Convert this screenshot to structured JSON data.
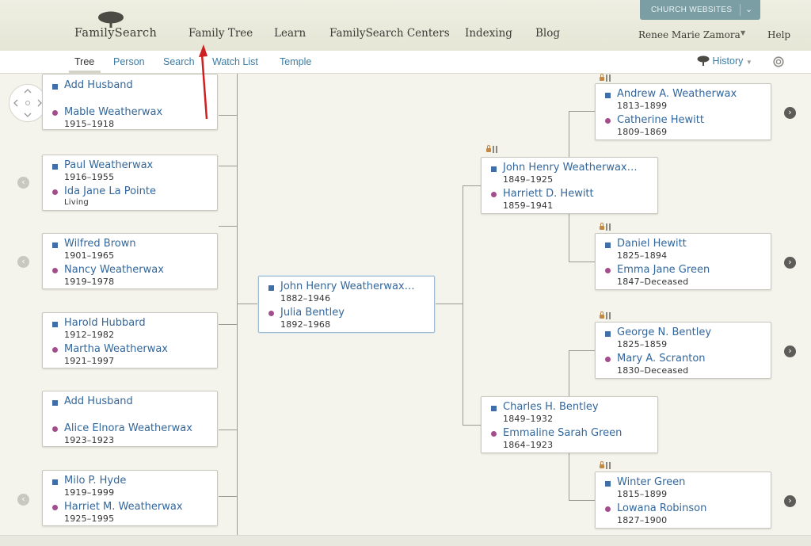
{
  "header": {
    "logo_text": "FamilySearch",
    "nav": [
      "Family Tree",
      "Learn",
      "FamilySearch Centers",
      "Indexing",
      "Blog"
    ],
    "church_websites": "CHURCH WEBSITES",
    "user_name": "Renee Marie Zamora",
    "help": "Help"
  },
  "subnav": {
    "items": [
      "Tree",
      "Person",
      "Search",
      "Watch List",
      "Temple"
    ],
    "active": "Tree",
    "history": "History"
  },
  "colors": {
    "link": "#33679c",
    "male": "#3f6ea8",
    "female": "#a24d8c",
    "annotation_arrow": "#d01f1f"
  },
  "zoom_controls": {
    "minus": "−",
    "plus": "+"
  },
  "children": [
    {
      "husband": "Add Husband",
      "husband_life": "",
      "wife": "Mable Weatherwax",
      "wife_life": "1915–1918"
    },
    {
      "husband": "Paul Weatherwax",
      "husband_life": "1916–1955",
      "wife": "Ida Jane La Pointe",
      "wife_life": "Living"
    },
    {
      "husband": "Wilfred Brown",
      "husband_life": "1901–1965",
      "wife": "Nancy Weatherwax",
      "wife_life": "1919–1978"
    },
    {
      "husband": "Harold Hubbard",
      "husband_life": "1912–1982",
      "wife": "Martha Weatherwax",
      "wife_life": "1921–1997"
    },
    {
      "husband": "Add Husband",
      "husband_life": "",
      "wife": "Alice Elnora Weatherwax",
      "wife_life": "1923–1923"
    },
    {
      "husband": "Milo P. Hyde",
      "husband_life": "1919–1999",
      "wife": "Harriet M. Weatherwax",
      "wife_life": "1925–1995"
    }
  ],
  "focus_couple": {
    "husband": "John Henry Weatherwax…",
    "husband_life": "1882–1946",
    "wife": "Julia Bentley",
    "wife_life": "1892–1968"
  },
  "parents": [
    {
      "husband": "John Henry Weatherwax…",
      "husband_life": "1849–1925",
      "wife": "Harriett D. Hewitt",
      "wife_life": "1859–1941"
    },
    {
      "husband": "Charles H. Bentley",
      "husband_life": "1849–1932",
      "wife": "Emmaline Sarah Green",
      "wife_life": "1864–1923"
    }
  ],
  "grandparents": [
    {
      "husband": "Andrew A. Weatherwax",
      "husband_life": "1813–1899",
      "wife": "Catherine Hewitt",
      "wife_life": "1809–1869"
    },
    {
      "husband": "Daniel Hewitt",
      "husband_life": "1825–1894",
      "wife": "Emma Jane Green",
      "wife_life": "1847–Deceased"
    },
    {
      "husband": "George N. Bentley",
      "husband_life": "1825–1859",
      "wife": "Mary A. Scranton",
      "wife_life": "1830–Deceased"
    },
    {
      "husband": "Winter Green",
      "husband_life": "1815–1899",
      "wife": "Lowana Robinson",
      "wife_life": "1827–1900"
    }
  ]
}
